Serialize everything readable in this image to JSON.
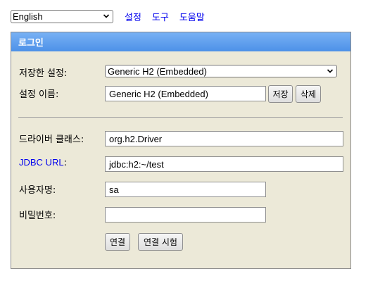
{
  "top": {
    "language": "English",
    "links": [
      "설정",
      "도구",
      "도움말"
    ]
  },
  "panel": {
    "title": "로그인",
    "saved_settings_label": "저장한 설정:",
    "saved_settings_value": "Generic H2 (Embedded)",
    "setting_name_label": "설정 이름:",
    "setting_name_value": "Generic H2 (Embedded)",
    "save_button": "저장",
    "delete_button": "삭제",
    "driver_label": "드라이버 클래스:",
    "driver_value": "org.h2.Driver",
    "jdbc_label": "JDBC URL",
    "jdbc_colon": ":",
    "jdbc_value": "jdbc:h2:~/test",
    "username_label": "사용자명:",
    "username_value": "sa",
    "password_label": "비밀번호:",
    "password_value": "",
    "connect_button": "연결",
    "test_connection_button": "연결 시험"
  }
}
